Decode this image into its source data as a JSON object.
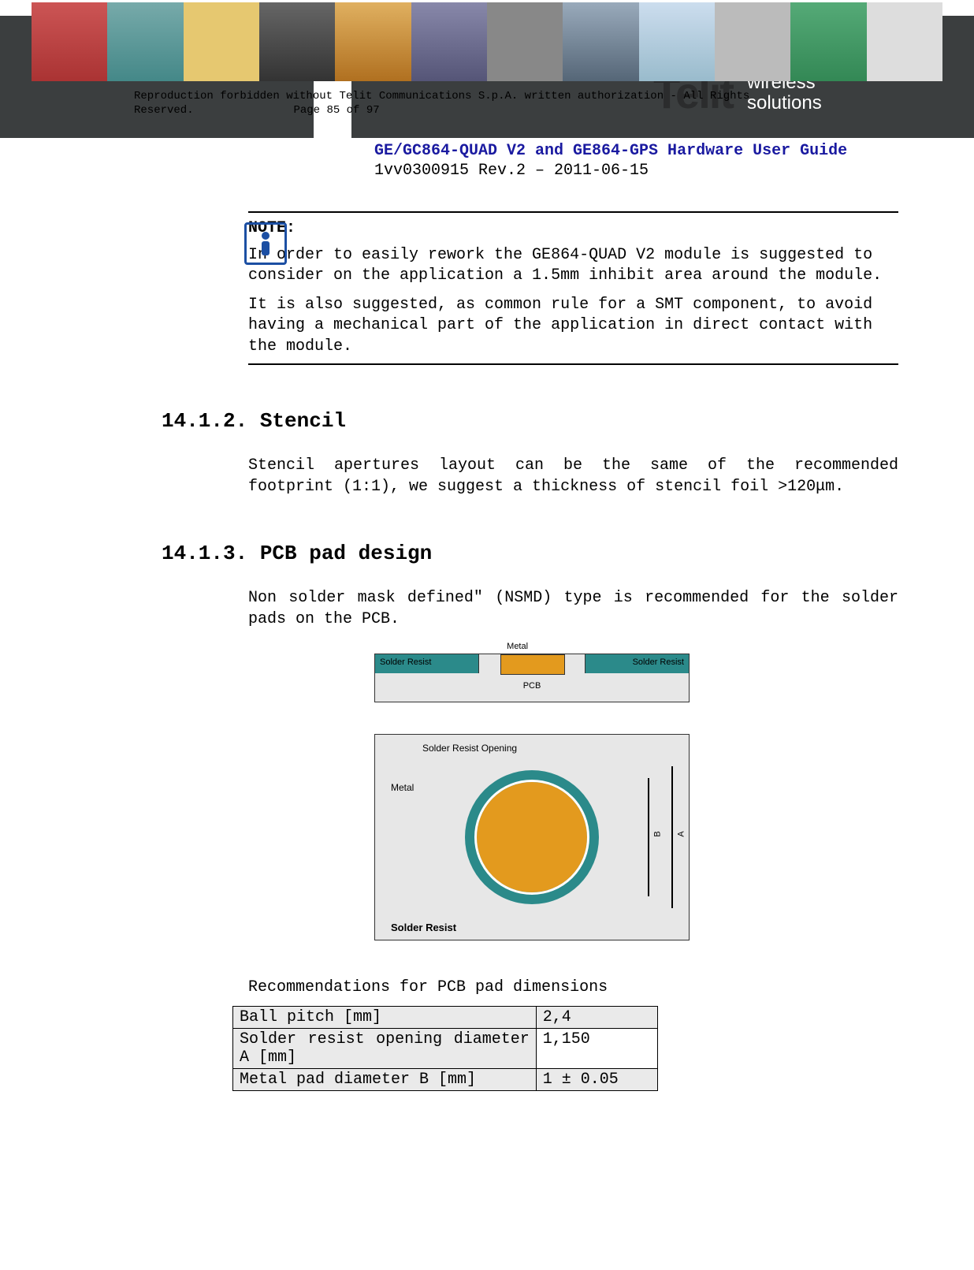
{
  "brand": {
    "name": "Telit",
    "tagline1": "wireless",
    "tagline2": "solutions"
  },
  "doc": {
    "title": "GE/GC864-QUAD V2 and GE864-GPS Hardware User Guide",
    "rev": "1vv0300915 Rev.2 – 2011-06-15"
  },
  "note": {
    "icon_name": "info-icon",
    "heading": "NOTE:",
    "p1": "In order to easily rework the GE864-QUAD V2 module is suggested to consider on the application a 1.5mm inhibit area around the module.",
    "p2": "It is also suggested, as common rule for a SMT component, to avoid having a mechanical part of the application in direct contact with the module."
  },
  "sec_stencil": {
    "num_title": "14.1.2. Stencil",
    "body": "Stencil apertures layout can be the same of the recommended footprint (1:1), we suggest a thickness of stencil foil >120μm."
  },
  "sec_pcb": {
    "num_title": "14.1.3. PCB pad design",
    "body": "Non solder mask defined\" (NSMD) type is recommended for the solder pads on the PCB."
  },
  "diagram": {
    "solder_resist": "Solder Resist",
    "metal": "Metal",
    "pcb": "PCB",
    "sr_opening": "Solder Resist Opening",
    "dimA": "A",
    "dimB": "B"
  },
  "recommend_caption": "Recommendations for PCB pad dimensions",
  "table": {
    "rows": [
      {
        "k": "Ball pitch [mm]",
        "v": "2,4"
      },
      {
        "k": "Solder resist opening diameter A [mm]",
        "v": "1,150"
      },
      {
        "k": "Metal pad diameter B [mm]",
        "v": "1 ± 0.05"
      }
    ]
  },
  "footer": {
    "line1": "Reproduction forbidden without Telit Communications S.p.A. written authorization - All Rights",
    "line2_a": "Reserved.",
    "line2_b": "Page 85 of 97"
  }
}
